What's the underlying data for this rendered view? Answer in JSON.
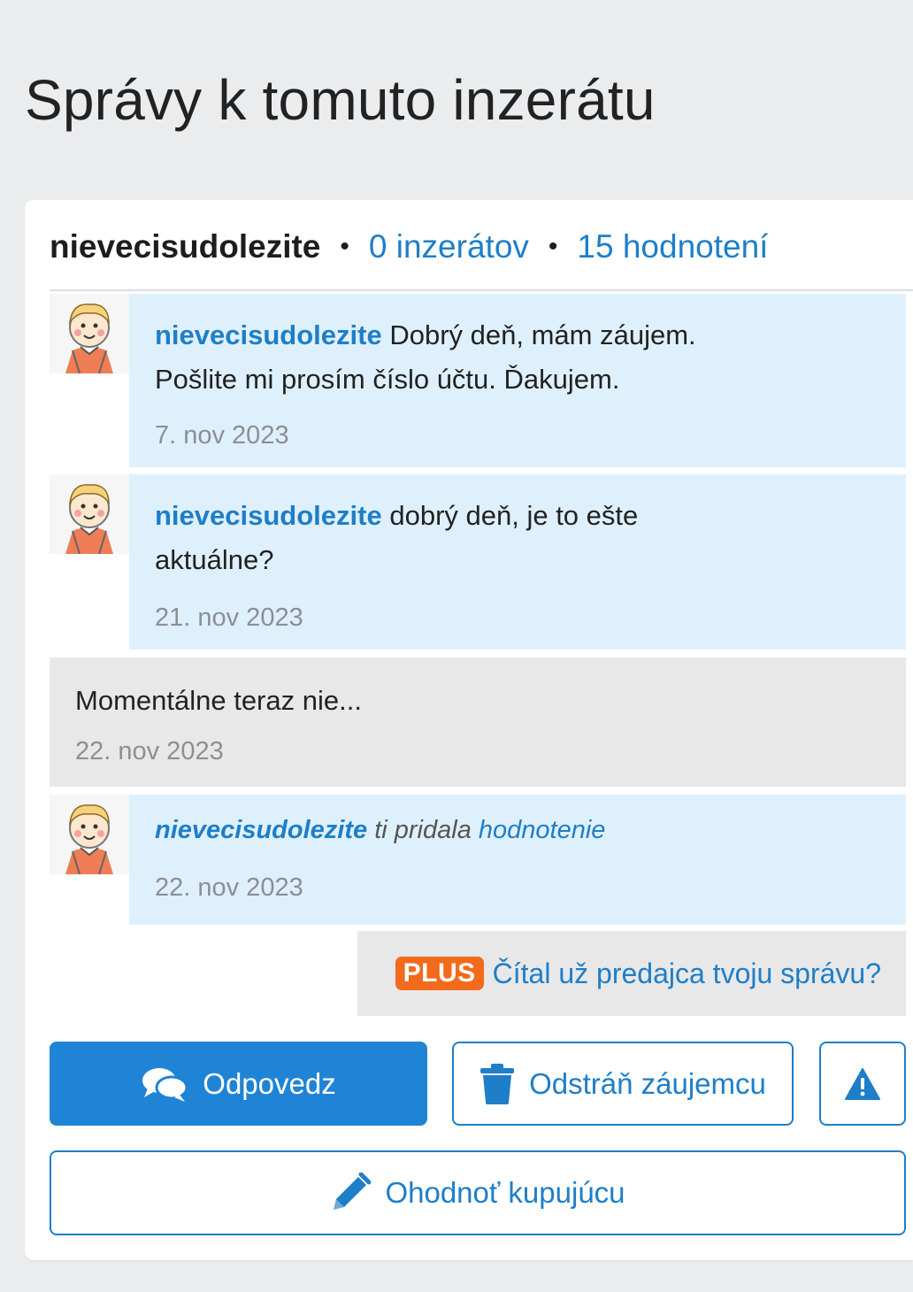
{
  "page": {
    "title": "Správy k tomuto inzerátu"
  },
  "header": {
    "username": "nievecisudolezite",
    "separator": "•",
    "ads_link": "0 inzerátov",
    "ratings_link": "15 hodnotení"
  },
  "messages": [
    {
      "type": "incoming",
      "author": "nievecisudolezite",
      "text": "Dobrý deň, mám záujem. Pošlite mi prosím číslo účtu. Ďakujem.",
      "date": "7. nov 2023"
    },
    {
      "type": "incoming",
      "author": "nievecisudolezite",
      "text": "dobrý deň, je to ešte aktuálne?",
      "date": "21. nov 2023"
    },
    {
      "type": "outgoing",
      "text": "Momentálne teraz nie...",
      "date": "22. nov 2023"
    },
    {
      "type": "event",
      "author": "nievecisudolezite",
      "text": "ti pridala",
      "link": "hodnotenie",
      "date": "22. nov 2023"
    }
  ],
  "plus": {
    "badge": "PLUS",
    "link": "Čítal už predajca tvoju správu?"
  },
  "actions": {
    "reply_label": "Odpovedz",
    "reply_icon": "chat-bubbles-icon",
    "remove_label": "Odstráň záujemcu",
    "remove_icon": "trash-icon",
    "report_icon": "warning-icon",
    "rate_label": "Ohodnoť kupujúcu",
    "rate_icon": "pencil-icon"
  },
  "colors": {
    "accent": "#1e7ec8",
    "incoming_bg": "#dff0fd",
    "outgoing_bg": "#e8e8e9",
    "plus_badge": "#f26a1b"
  }
}
